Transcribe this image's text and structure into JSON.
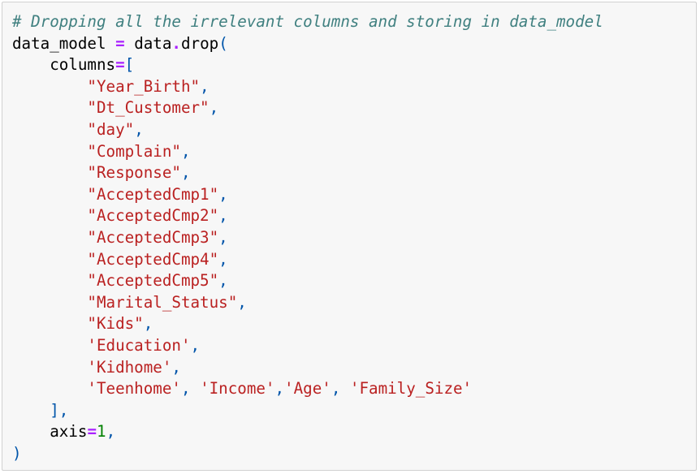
{
  "cell": {
    "line_comment": "# Dropping all the irrelevant columns and storing in data_model",
    "line_assign": {
      "target": "data_model ",
      "eq": "=",
      "expr": " data",
      "dot": ".",
      "method": "drop",
      "paren": "("
    },
    "line_columns": {
      "indent": "    ",
      "kw": "columns",
      "eq": "=",
      "bracket": "["
    },
    "items": [
      {
        "text": "\"Year_Birth\"",
        "sep": ","
      },
      {
        "text": "\"Dt_Customer\"",
        "sep": ","
      },
      {
        "text": "\"day\"",
        "sep": ","
      },
      {
        "text": "\"Complain\"",
        "sep": ","
      },
      {
        "text": "\"Response\"",
        "sep": ","
      },
      {
        "text": "\"AcceptedCmp1\"",
        "sep": ","
      },
      {
        "text": "\"AcceptedCmp2\"",
        "sep": ","
      },
      {
        "text": "\"AcceptedCmp3\"",
        "sep": ","
      },
      {
        "text": "\"AcceptedCmp4\"",
        "sep": ","
      },
      {
        "text": "\"AcceptedCmp5\"",
        "sep": ","
      },
      {
        "text": "\"Marital_Status\"",
        "sep": ","
      },
      {
        "text": "\"Kids\"",
        "sep": ","
      },
      {
        "text": "'Education'",
        "sep": ","
      },
      {
        "text": "'Kidhome'",
        "sep": ","
      }
    ],
    "last_items": {
      "a": "'Teenhome'",
      "sep1": ", ",
      "b": "'Income'",
      "sep2": ",",
      "c": "'Age'",
      "sep3": ", ",
      "d": "'Family_Size'"
    },
    "line_close_bracket": "],",
    "line_axis": {
      "kw": "axis",
      "eq": "=",
      "num": "1",
      "sep": ","
    },
    "line_close_paren": ")"
  },
  "colors": {
    "comment": "#408080",
    "string": "#ba2121",
    "operator": "#aa22ff",
    "number": "#008000",
    "punctuation": "#0055aa",
    "cell_background": "#f7f7f7"
  }
}
